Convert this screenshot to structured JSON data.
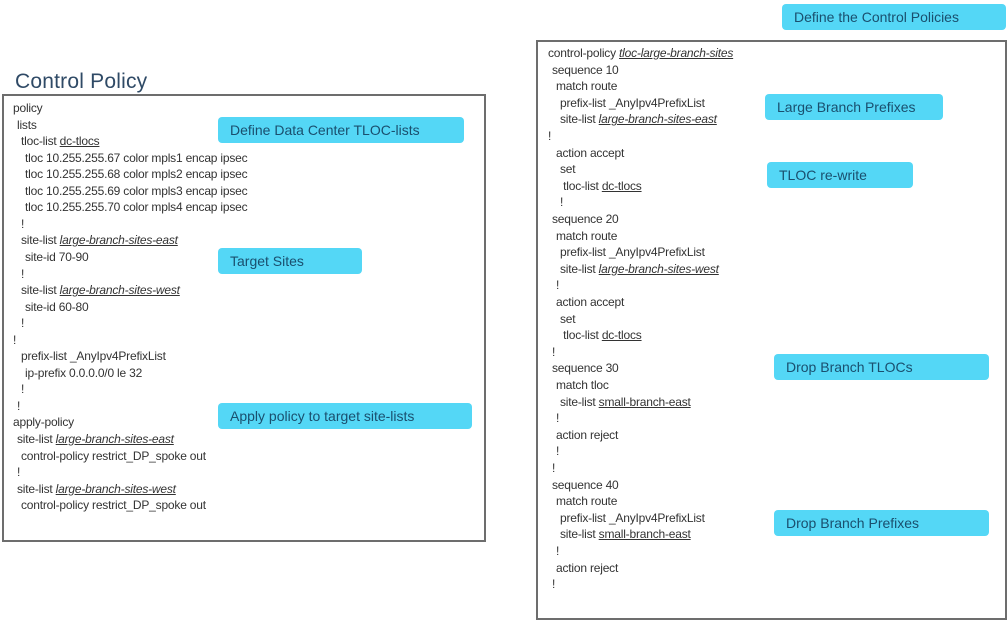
{
  "title": "Control Policy",
  "left_box": {
    "lines": [
      {
        "indent": 0,
        "text": "policy"
      },
      {
        "indent": 1,
        "text": "lists"
      },
      {
        "indent": 2,
        "text": "tloc-list ",
        "ref": "dc-tlocs",
        "italic": false
      },
      {
        "indent": 3,
        "text": "tloc 10.255.255.67 color mpls1 encap ipsec"
      },
      {
        "indent": 3,
        "text": "tloc 10.255.255.68 color mpls2 encap ipsec"
      },
      {
        "indent": 3,
        "text": "tloc 10.255.255.69 color mpls3 encap ipsec"
      },
      {
        "indent": 3,
        "text": "tloc 10.255.255.70 color mpls4 encap ipsec"
      },
      {
        "indent": 2,
        "text": "!"
      },
      {
        "indent": 2,
        "text": "site-list ",
        "ref": "large-branch-sites-east",
        "italic": true
      },
      {
        "indent": 3,
        "text": "site-id 70-90"
      },
      {
        "indent": 2,
        "text": "!"
      },
      {
        "indent": 2,
        "text": "site-list ",
        "ref": "large-branch-sites-west",
        "italic": true
      },
      {
        "indent": 3,
        "text": "site-id 60-80"
      },
      {
        "indent": 2,
        "text": "!"
      },
      {
        "indent": 0,
        "text": "!"
      },
      {
        "indent": 2,
        "text": "prefix-list _AnyIpv4PrefixList"
      },
      {
        "indent": 3,
        "text": "ip-prefix 0.0.0.0/0 le 32"
      },
      {
        "indent": 2,
        "text": "!"
      },
      {
        "indent": 1,
        "text": "!"
      },
      {
        "indent": 0,
        "text": "apply-policy"
      },
      {
        "indent": 1,
        "text": "site-list ",
        "ref": "large-branch-sites-east",
        "italic": true
      },
      {
        "indent": 2,
        "text": "control-policy restrict_DP_spoke out"
      },
      {
        "indent": 1,
        "text": "!"
      },
      {
        "indent": 1,
        "text": "site-list ",
        "ref": "large-branch-sites-west",
        "italic": true
      },
      {
        "indent": 2,
        "text": "control-policy restrict_DP_spoke out"
      }
    ]
  },
  "right_box": {
    "lines": [
      {
        "indent": 0,
        "text": "control-policy ",
        "ref": "tloc-large-branch-sites",
        "italic": true
      },
      {
        "indent": 1,
        "text": "sequence 10"
      },
      {
        "indent": 2,
        "text": "match route"
      },
      {
        "indent": 3,
        "text": "prefix-list _AnyIpv4PrefixList"
      },
      {
        "indent": 3,
        "text": "site-list ",
        "ref": "large-branch-sites-east",
        "italic": true
      },
      {
        "indent": 0,
        "text": "!"
      },
      {
        "indent": 2,
        "text": "action accept"
      },
      {
        "indent": 3,
        "text": "set"
      },
      {
        "indent": 3,
        "text": " tloc-list ",
        "ref": "dc-tlocs",
        "italic": false
      },
      {
        "indent": 3,
        "text": "!"
      },
      {
        "indent": 1,
        "text": "sequence 20"
      },
      {
        "indent": 2,
        "text": "match route"
      },
      {
        "indent": 3,
        "text": "prefix-list _AnyIpv4PrefixList"
      },
      {
        "indent": 3,
        "text": "site-list ",
        "ref": "large-branch-sites-west",
        "italic": true
      },
      {
        "indent": 2,
        "text": "!"
      },
      {
        "indent": 2,
        "text": "action accept"
      },
      {
        "indent": 3,
        "text": "set"
      },
      {
        "indent": 3,
        "text": " tloc-list ",
        "ref": "dc-tlocs",
        "italic": false
      },
      {
        "indent": 1,
        "text": "!"
      },
      {
        "indent": 1,
        "text": "sequence 30"
      },
      {
        "indent": 2,
        "text": "match tloc"
      },
      {
        "indent": 3,
        "text": "site-list ",
        "ref": "small-branch-east",
        "italic": false
      },
      {
        "indent": 2,
        "text": "!"
      },
      {
        "indent": 2,
        "text": "action reject"
      },
      {
        "indent": 2,
        "text": "!"
      },
      {
        "indent": 1,
        "text": "!"
      },
      {
        "indent": 1,
        "text": "sequence 40"
      },
      {
        "indent": 2,
        "text": "match route"
      },
      {
        "indent": 3,
        "text": "prefix-list _AnyIpv4PrefixList"
      },
      {
        "indent": 3,
        "text": "site-list ",
        "ref": "small-branch-east",
        "italic": false
      },
      {
        "indent": 2,
        "text": "!"
      },
      {
        "indent": 2,
        "text": "action reject"
      },
      {
        "indent": 1,
        "text": "!"
      }
    ]
  },
  "callouts": {
    "define_dc_tloc_lists": "Define Data Center TLOC-lists",
    "target_sites": "Target Sites",
    "apply_policy": "Apply policy to target site-lists",
    "define_control_policies": "Define the Control Policies",
    "large_branch_prefixes": "Large Branch Prefixes",
    "tloc_rewrite": "TLOC re-write",
    "drop_branch_tlocs": "Drop Branch TLOCs",
    "drop_branch_prefixes": "Drop Branch Prefixes"
  },
  "colors": {
    "callout_bg": "#54d7f6",
    "callout_text": "#1a4f6e",
    "title": "#2f4a66",
    "border": "#6d6d6d"
  }
}
